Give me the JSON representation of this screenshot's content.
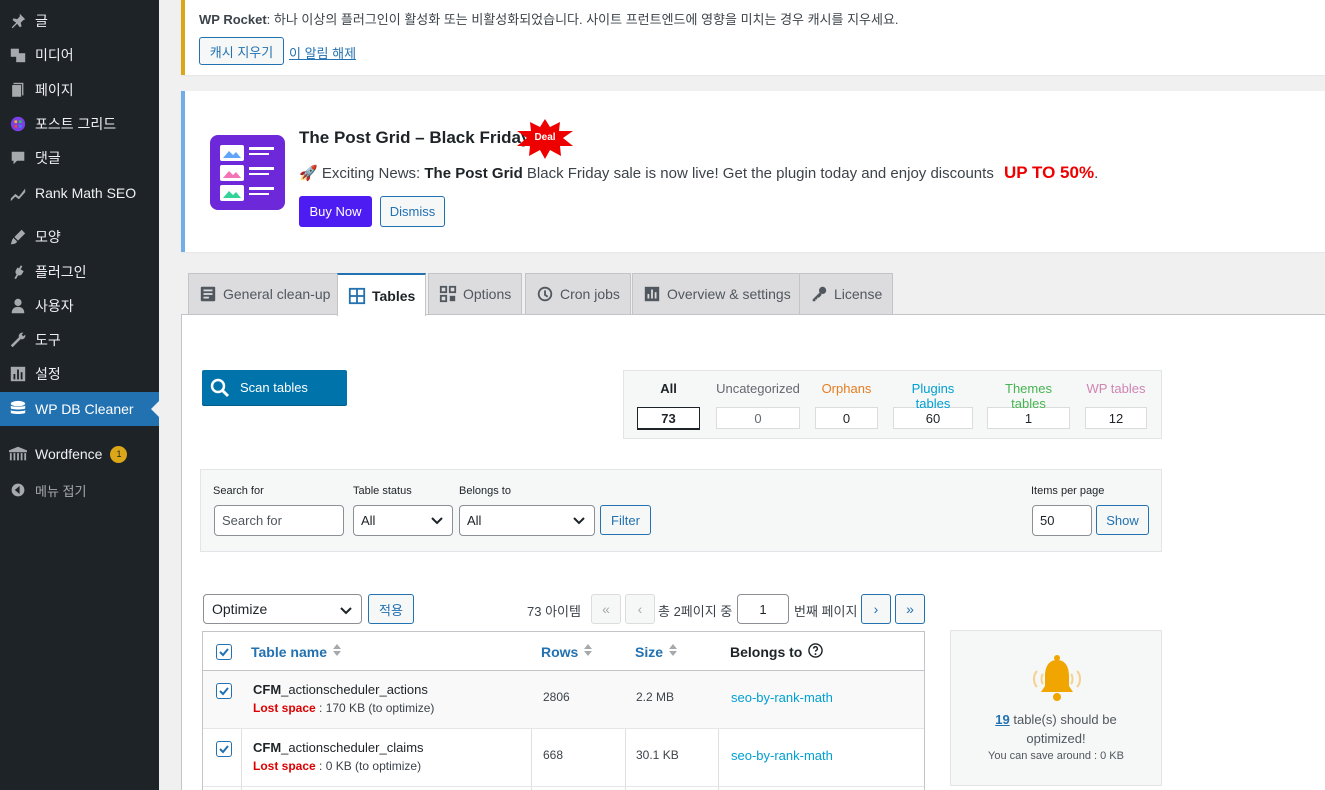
{
  "sidebar": {
    "items": [
      {
        "label": "글",
        "icon": "pin-icon"
      },
      {
        "label": "미디어",
        "icon": "media-icon"
      },
      {
        "label": "페이지",
        "icon": "page-icon"
      },
      {
        "label": "포스트 그리드",
        "icon": "post-grid-icon"
      },
      {
        "label": "댓글",
        "icon": "comment-icon"
      },
      {
        "label": "Rank Math SEO",
        "icon": "rank-math-icon"
      },
      {
        "label": "모양",
        "icon": "brush-icon"
      },
      {
        "label": "플러그인",
        "icon": "plugin-icon"
      },
      {
        "label": "사용자",
        "icon": "user-icon"
      },
      {
        "label": "도구",
        "icon": "wrench-icon"
      },
      {
        "label": "설정",
        "icon": "settings-icon"
      },
      {
        "label": "WP DB Cleaner",
        "icon": "database-icon"
      },
      {
        "label": "Wordfence",
        "icon": "wordfence-icon",
        "badge": "1"
      },
      {
        "label": "메뉴 접기",
        "icon": "collapse-icon"
      }
    ]
  },
  "rocket_notice": {
    "brand": "WP Rocket",
    "message": ": 하나 이상의 플러그인이 활성화 또는 비활성화되었습니다. 사이트 프런트엔드에 영향을 미치는 경우 캐시를 지우세요.",
    "clear_button": "캐시 지우기",
    "dismiss_link": "이 알림 해제"
  },
  "grid_notice": {
    "title": "The Post Grid – Black Friday",
    "deal_badge": "Deal",
    "msg_emoji": "🚀",
    "msg_prefix": " Exciting News: ",
    "msg_bold": "The Post Grid",
    "msg_suffix": " Black Friday sale is now live! Get the plugin today and enjoy discounts",
    "msg_highlight": "UP TO 50%",
    "msg_end": ".",
    "buy_button": "Buy Now",
    "dismiss_button": "Dismiss"
  },
  "tabs": [
    {
      "label": "General clean-up",
      "icon": "document-icon"
    },
    {
      "label": "Tables",
      "icon": "table-icon",
      "active": true
    },
    {
      "label": "Options",
      "icon": "options-icon"
    },
    {
      "label": "Cron jobs",
      "icon": "clock-icon"
    },
    {
      "label": "Overview & settings",
      "icon": "chart-icon"
    },
    {
      "label": "License",
      "icon": "key-icon"
    }
  ],
  "scan_button": "Scan tables",
  "categories": [
    {
      "label": "All",
      "count": "73",
      "color": "#1d2327"
    },
    {
      "label": "Uncategorized",
      "count": "0",
      "color": "#646970"
    },
    {
      "label": "Orphans",
      "count": "0",
      "color": "#e67e22"
    },
    {
      "label": "Plugins tables",
      "count": "60",
      "color": "#00a0d2"
    },
    {
      "label": "Themes tables",
      "count": "1",
      "color": "#46b450"
    },
    {
      "label": "WP tables",
      "count": "12",
      "color": "#d085b3"
    }
  ],
  "filters": {
    "search_label": "Search for",
    "search_placeholder": "Search for",
    "status_label": "Table status",
    "status_value": "All",
    "belongs_label": "Belongs to",
    "belongs_value": "All",
    "filter_button": "Filter",
    "per_page_label": "Items per page",
    "per_page_value": "50",
    "show_button": "Show"
  },
  "bulk": {
    "action": "Optimize",
    "apply_button": "적용"
  },
  "pagination": {
    "items": "73 아이템",
    "first": "«",
    "prev": "‹",
    "total_text": "총 2페이지 중",
    "current": "1",
    "suffix": "번째 페이지",
    "next": "›",
    "last": "»"
  },
  "table": {
    "headers": {
      "name": "Table name",
      "rows": "Rows",
      "size": "Size",
      "belongs": "Belongs to"
    },
    "rows": [
      {
        "prefix": "CFM",
        "name": "_actionscheduler_actions",
        "lost_label": "Lost space",
        "lost_value": " : 170 KB (to optimize)",
        "rows": "2806",
        "size": "2.2 MB",
        "belongs": "seo-by-rank-math"
      },
      {
        "prefix": "CFM",
        "name": "_actionscheduler_claims",
        "lost_label": "Lost space",
        "lost_value": " : 0 KB (to optimize)",
        "rows": "668",
        "size": "30.1 KB",
        "belongs": "seo-by-rank-math"
      }
    ]
  },
  "optimize_box": {
    "count": "19",
    "line1_suffix": " table(s) should be",
    "line2": "optimized!",
    "line3": "You can save around : 0 KB"
  }
}
